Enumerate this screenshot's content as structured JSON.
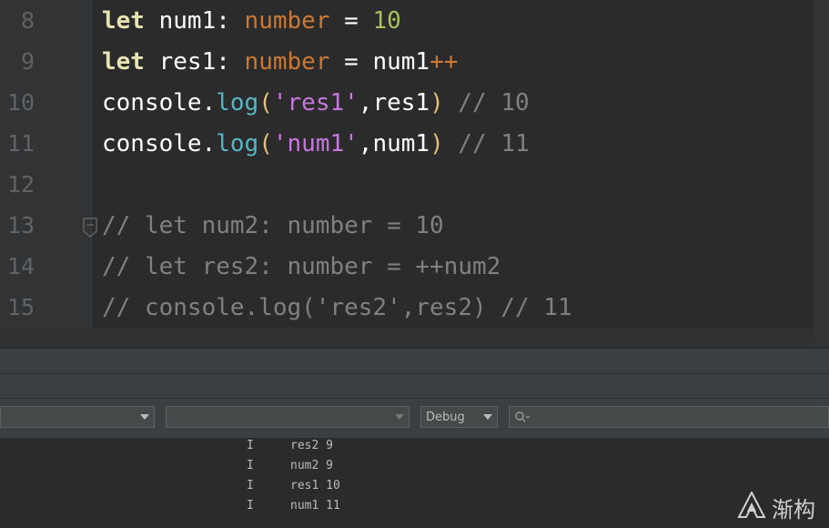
{
  "editor": {
    "line_numbers": [
      "8",
      "9",
      "10",
      "11",
      "12",
      "13",
      "14",
      "15"
    ],
    "lines": [
      [
        {
          "t": "let",
          "c": "kw"
        },
        {
          "t": " num1",
          "c": ""
        },
        {
          "t": ":",
          "c": ""
        },
        {
          "t": " number",
          "c": "ty"
        },
        {
          "t": " = ",
          "c": ""
        },
        {
          "t": "10",
          "c": "num-lit"
        }
      ],
      [
        {
          "t": "let",
          "c": "kw"
        },
        {
          "t": " res1",
          "c": ""
        },
        {
          "t": ":",
          "c": ""
        },
        {
          "t": " number",
          "c": "ty"
        },
        {
          "t": " = ",
          "c": ""
        },
        {
          "t": "num1",
          "c": ""
        },
        {
          "t": "++",
          "c": "op"
        }
      ],
      [
        {
          "t": "console",
          "c": ""
        },
        {
          "t": ".",
          "c": ""
        },
        {
          "t": "log",
          "c": "fn"
        },
        {
          "t": "(",
          "c": "par"
        },
        {
          "t": "'res1'",
          "c": "str"
        },
        {
          "t": ",",
          "c": ""
        },
        {
          "t": "res1",
          "c": ""
        },
        {
          "t": ")",
          "c": "par"
        },
        {
          "t": " // 10",
          "c": "cm"
        }
      ],
      [
        {
          "t": "console",
          "c": ""
        },
        {
          "t": ".",
          "c": ""
        },
        {
          "t": "log",
          "c": "fn"
        },
        {
          "t": "(",
          "c": "par"
        },
        {
          "t": "'num1'",
          "c": "str"
        },
        {
          "t": ",",
          "c": ""
        },
        {
          "t": "num1",
          "c": ""
        },
        {
          "t": ")",
          "c": "par"
        },
        {
          "t": " // 11",
          "c": "cm"
        }
      ],
      [],
      [
        {
          "t": "// let num2: number = 10",
          "c": "cm"
        }
      ],
      [
        {
          "t": "// let res2: number = ++num2",
          "c": "cm"
        }
      ],
      [
        {
          "t": "// console.log('res2',res2) // 11",
          "c": "cm"
        }
      ]
    ]
  },
  "toolbar": {
    "device_select_value": "",
    "process_select_value": "",
    "log_level_value": "Debug",
    "search_placeholder": ""
  },
  "logcat": {
    "rows": [
      {
        "level": "I",
        "message": "res2 9"
      },
      {
        "level": "I",
        "message": "num2 9"
      },
      {
        "level": "I",
        "message": "res1 10"
      },
      {
        "level": "I",
        "message": "num1 11"
      }
    ]
  },
  "watermark": {
    "text": "渐构"
  }
}
